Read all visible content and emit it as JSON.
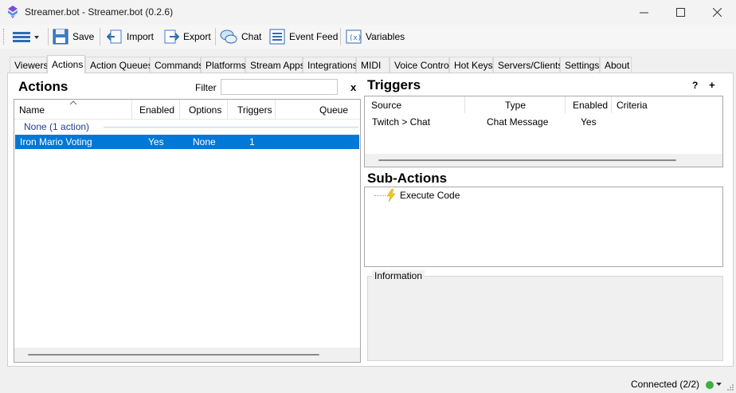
{
  "window": {
    "title": "Streamer.bot - Streamer.bot (0.2.6)",
    "accent": "#0078d7"
  },
  "toolbar": {
    "save_label": "Save",
    "import_label": "Import",
    "export_label": "Export",
    "chat_label": "Chat",
    "eventfeed_label": "Event Feed",
    "variables_label": "Variables"
  },
  "tabs": [
    {
      "label": "Viewers"
    },
    {
      "label": "Actions"
    },
    {
      "label": "Action Queues"
    },
    {
      "label": "Commands"
    },
    {
      "label": "Platforms"
    },
    {
      "label": "Stream Apps"
    },
    {
      "label": "Integrations"
    },
    {
      "label": "MIDI"
    },
    {
      "label": "Voice Control"
    },
    {
      "label": "Hot Keys"
    },
    {
      "label": "Servers/Clients"
    },
    {
      "label": "Settings"
    },
    {
      "label": "About"
    }
  ],
  "actions": {
    "title": "Actions",
    "filter_label": "Filter",
    "filter_value": "",
    "clear_label": "x",
    "columns": {
      "name": "Name",
      "enabled": "Enabled",
      "options": "Options",
      "triggers": "Triggers",
      "queue": "Queue"
    },
    "group_label": "None (1 action)",
    "rows": [
      {
        "name": "Iron Mario Voting",
        "enabled": "Yes",
        "options": "None",
        "triggers": "1",
        "queue": ""
      }
    ]
  },
  "triggers": {
    "title": "Triggers",
    "help_label": "?",
    "add_label": "+",
    "columns": {
      "source": "Source",
      "type": "Type",
      "enabled": "Enabled",
      "criteria": "Criteria"
    },
    "rows": [
      {
        "source": "Twitch > Chat",
        "type": "Chat Message",
        "enabled": "Yes",
        "criteria": ""
      }
    ]
  },
  "subactions": {
    "title": "Sub-Actions",
    "items": [
      {
        "label": "Execute Code"
      }
    ]
  },
  "information": {
    "label": "Information"
  },
  "status": {
    "connection": "Connected (2/2)",
    "color": "#3cb043"
  }
}
